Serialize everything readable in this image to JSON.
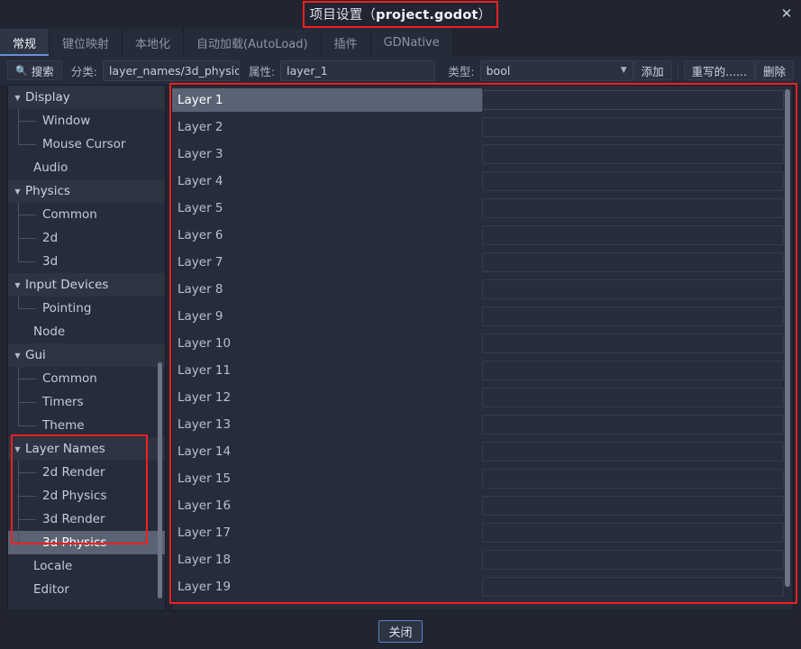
{
  "window": {
    "title_prefix": "项目设置（",
    "title_file": "project.godot",
    "title_suffix": "）",
    "close_icon": "close-icon",
    "close_glyph": "✕"
  },
  "tabs": [
    {
      "label": "常规",
      "active": true
    },
    {
      "label": "键位映射",
      "active": false
    },
    {
      "label": "本地化",
      "active": false
    },
    {
      "label": "自动加载(AutoLoad)",
      "active": false
    },
    {
      "label": "插件",
      "active": false
    },
    {
      "label": "GDNative",
      "active": false
    }
  ],
  "toolbar": {
    "search_label": "搜索",
    "search_icon": "search-icon",
    "category_label": "分类:",
    "category_value": "layer_names/3d_physic",
    "property_label": "属性:",
    "property_value": "layer_1",
    "type_label": "类型:",
    "type_value": "bool",
    "type_chevron": "chevron-down-icon",
    "add_label": "添加",
    "override_label": "重写的......",
    "delete_label": "删除"
  },
  "sidebar": {
    "items": [
      {
        "label": "Display",
        "kind": "group",
        "expanded": true,
        "selected": false
      },
      {
        "label": "Window",
        "kind": "child",
        "selected": false
      },
      {
        "label": "Mouse Cursor",
        "kind": "child",
        "selected": false,
        "last": true
      },
      {
        "label": "Audio",
        "kind": "plain",
        "selected": false
      },
      {
        "label": "Physics",
        "kind": "group",
        "expanded": true,
        "selected": false
      },
      {
        "label": "Common",
        "kind": "child",
        "selected": false
      },
      {
        "label": "2d",
        "kind": "child",
        "selected": false
      },
      {
        "label": "3d",
        "kind": "child",
        "selected": false,
        "last": true
      },
      {
        "label": "Input Devices",
        "kind": "group",
        "expanded": true,
        "selected": false
      },
      {
        "label": "Pointing",
        "kind": "child",
        "selected": false,
        "last": true
      },
      {
        "label": "Node",
        "kind": "plain",
        "selected": false
      },
      {
        "label": "Gui",
        "kind": "group",
        "expanded": true,
        "selected": false
      },
      {
        "label": "Common",
        "kind": "child",
        "selected": false
      },
      {
        "label": "Timers",
        "kind": "child",
        "selected": false
      },
      {
        "label": "Theme",
        "kind": "child",
        "selected": false,
        "last": true
      },
      {
        "label": "Layer Names",
        "kind": "group",
        "expanded": true,
        "selected": false
      },
      {
        "label": "2d Render",
        "kind": "child",
        "selected": false
      },
      {
        "label": "2d Physics",
        "kind": "child",
        "selected": false
      },
      {
        "label": "3d Render",
        "kind": "child",
        "selected": false
      },
      {
        "label": "3d Physics",
        "kind": "child",
        "selected": true,
        "last": true
      },
      {
        "label": "Locale",
        "kind": "plain",
        "selected": false
      },
      {
        "label": "Editor",
        "kind": "plain",
        "selected": false
      }
    ]
  },
  "list": {
    "rows": [
      {
        "name": "Layer 1",
        "value": "",
        "selected": true
      },
      {
        "name": "Layer 2",
        "value": "",
        "selected": false
      },
      {
        "name": "Layer 3",
        "value": "",
        "selected": false
      },
      {
        "name": "Layer 4",
        "value": "",
        "selected": false
      },
      {
        "name": "Layer 5",
        "value": "",
        "selected": false
      },
      {
        "name": "Layer 6",
        "value": "",
        "selected": false
      },
      {
        "name": "Layer 7",
        "value": "",
        "selected": false
      },
      {
        "name": "Layer 8",
        "value": "",
        "selected": false
      },
      {
        "name": "Layer 9",
        "value": "",
        "selected": false
      },
      {
        "name": "Layer 10",
        "value": "",
        "selected": false
      },
      {
        "name": "Layer 11",
        "value": "",
        "selected": false
      },
      {
        "name": "Layer 12",
        "value": "",
        "selected": false
      },
      {
        "name": "Layer 13",
        "value": "",
        "selected": false
      },
      {
        "name": "Layer 14",
        "value": "",
        "selected": false
      },
      {
        "name": "Layer 15",
        "value": "",
        "selected": false
      },
      {
        "name": "Layer 16",
        "value": "",
        "selected": false
      },
      {
        "name": "Layer 17",
        "value": "",
        "selected": false
      },
      {
        "name": "Layer 18",
        "value": "",
        "selected": false
      },
      {
        "name": "Layer 19",
        "value": "",
        "selected": false
      }
    ]
  },
  "footer": {
    "close_label": "关闭"
  },
  "colors": {
    "highlight_box": "#f02020",
    "selection": "#5a6374",
    "panel_bg": "#262c39",
    "window_bg": "#202531",
    "focus_border": "#5b82c9"
  }
}
